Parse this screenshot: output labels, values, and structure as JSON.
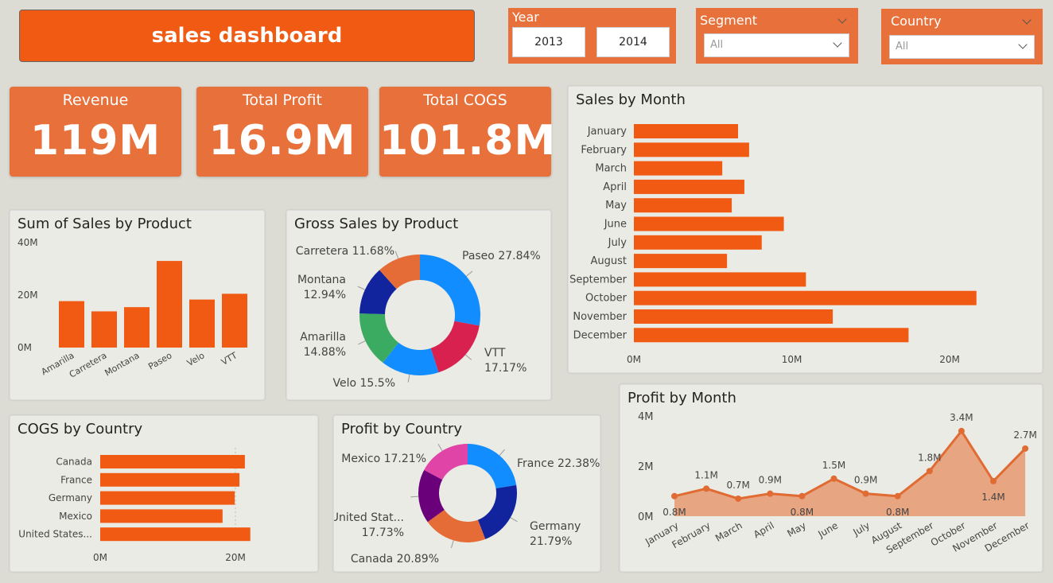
{
  "header": {
    "title": "sales dashboard"
  },
  "filters": {
    "year": {
      "label": "Year",
      "options": [
        "2013",
        "2014"
      ]
    },
    "segment": {
      "label": "Segment",
      "value": "All"
    },
    "country": {
      "label": "Country",
      "value": "All"
    }
  },
  "kpis": {
    "revenue": {
      "label": "Revenue",
      "value": "119M"
    },
    "profit": {
      "label": "Total Profit",
      "value": "16.9M"
    },
    "cogs": {
      "label": "Total COGS",
      "value": "101.8M"
    }
  },
  "colors": {
    "accent": "#f05a13",
    "kpi": "#e8703a",
    "area": "#e8a582",
    "line": "#e06b33"
  },
  "chart_data": [
    {
      "id": "sales-by-product",
      "type": "bar",
      "title": "Sum of Sales by Product",
      "categories": [
        "Amarilla",
        "Carretera",
        "Montana",
        "Paseo",
        "Velo",
        "VTT"
      ],
      "values": [
        17.7,
        13.8,
        15.4,
        33.0,
        18.3,
        20.5
      ],
      "yticks": [
        "0M",
        "20M",
        "40M"
      ],
      "ylim": [
        0,
        40
      ]
    },
    {
      "id": "gross-sales-by-product",
      "type": "pie",
      "title": "Gross Sales by Product",
      "labels": [
        "Paseo",
        "VTT",
        "Velo",
        "Amarilla",
        "Montana",
        "Carretera"
      ],
      "values": [
        27.84,
        17.17,
        15.5,
        14.88,
        12.94,
        11.68
      ],
      "value_labels": [
        "27.84%",
        "17.17%",
        "15.5%",
        "14.88%",
        "12.94%",
        "11.68%"
      ],
      "colors": [
        "#118dff",
        "#d9214f",
        "#118dff",
        "#3cab62",
        "#12239e",
        "#e66c37"
      ]
    },
    {
      "id": "sales-by-month",
      "type": "bar",
      "orientation": "horizontal",
      "title": "Sales by Month",
      "categories": [
        "January",
        "February",
        "March",
        "April",
        "May",
        "June",
        "July",
        "August",
        "September",
        "October",
        "November",
        "December"
      ],
      "values": [
        6.6,
        7.3,
        5.6,
        7.0,
        6.2,
        9.5,
        8.1,
        5.9,
        10.9,
        21.7,
        12.6,
        17.4
      ],
      "xticks": [
        "0M",
        "10M",
        "20M"
      ],
      "xlim": [
        0,
        20
      ]
    },
    {
      "id": "cogs-by-country",
      "type": "bar",
      "orientation": "horizontal",
      "title": "COGS by Country",
      "categories": [
        "Canada",
        "France",
        "Germany",
        "Mexico",
        "United States..."
      ],
      "values": [
        21.4,
        20.6,
        19.9,
        18.1,
        22.2
      ],
      "xticks": [
        "0M",
        "20M"
      ],
      "xlim": [
        0,
        20
      ]
    },
    {
      "id": "profit-by-country",
      "type": "pie",
      "title": "Profit by Country",
      "labels": [
        "France",
        "Germany",
        "Canada",
        "United Stat...",
        "Mexico"
      ],
      "values": [
        22.38,
        21.79,
        20.89,
        17.73,
        17.21
      ],
      "value_labels": [
        "22.38%",
        "21.79%",
        "20.89%",
        "17.73%",
        "17.21%"
      ],
      "colors": [
        "#118dff",
        "#12239e",
        "#e66c37",
        "#6b007b",
        "#e044a7"
      ]
    },
    {
      "id": "profit-by-month",
      "type": "area",
      "title": "Profit by Month",
      "categories": [
        "January",
        "February",
        "March",
        "April",
        "May",
        "June",
        "July",
        "August",
        "September",
        "October",
        "November",
        "December"
      ],
      "values": [
        0.8,
        1.1,
        0.7,
        0.9,
        0.8,
        1.5,
        0.9,
        0.8,
        1.8,
        3.4,
        1.4,
        2.7
      ],
      "value_labels": [
        "0.8M",
        "1.1M",
        "0.7M",
        "0.9M",
        "0.8M",
        "1.5M",
        "0.9M",
        "0.8M",
        "1.8M",
        "3.4M",
        "1.4M",
        "2.7M"
      ],
      "yticks": [
        "0M",
        "2M",
        "4M"
      ],
      "ylim": [
        0,
        4
      ]
    }
  ]
}
